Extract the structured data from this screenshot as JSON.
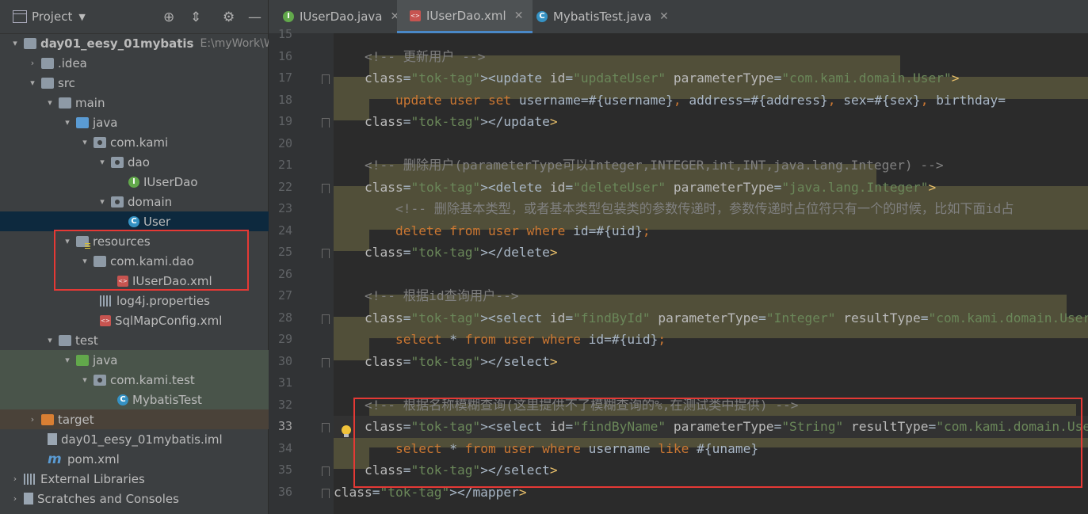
{
  "project_panel": {
    "title": "Project",
    "tree": [
      {
        "label": "day01_eesy_01mybatis",
        "path": "E:\\myWork\\W"
      },
      {
        "label": ".idea"
      },
      {
        "label": "src"
      },
      {
        "label": "main"
      },
      {
        "label": "java"
      },
      {
        "label": "com.kami"
      },
      {
        "label": "dao"
      },
      {
        "label": "IUserDao"
      },
      {
        "label": "domain"
      },
      {
        "label": "User"
      },
      {
        "label": "resources"
      },
      {
        "label": "com.kami.dao"
      },
      {
        "label": "IUserDao.xml"
      },
      {
        "label": "log4j.properties"
      },
      {
        "label": "SqlMapConfig.xml"
      },
      {
        "label": "test"
      },
      {
        "label": "java"
      },
      {
        "label": "com.kami.test"
      },
      {
        "label": "MybatisTest"
      },
      {
        "label": "target"
      },
      {
        "label": "day01_eesy_01mybatis.iml"
      },
      {
        "label": "pom.xml"
      },
      {
        "label": "External Libraries"
      },
      {
        "label": "Scratches and Consoles"
      }
    ]
  },
  "tabs": [
    {
      "label": "IUserDao.java",
      "active": false
    },
    {
      "label": "IUserDao.xml",
      "active": true
    },
    {
      "label": "MybatisTest.java",
      "active": false
    }
  ],
  "editor": {
    "current_line": 33,
    "lines": [
      {
        "n": "15",
        "text": ""
      },
      {
        "n": "16",
        "text": "    <!-- 更新用户 -->"
      },
      {
        "n": "17",
        "text": "    <update id=\"updateUser\" parameterType=\"com.kami.domain.User\">"
      },
      {
        "n": "18",
        "text": "        update user set username=#{username}, address=#{address}, sex=#{sex}, birthday="
      },
      {
        "n": "19",
        "text": "    </update>"
      },
      {
        "n": "20",
        "text": ""
      },
      {
        "n": "21",
        "text": "    <!-- 删除用户(parameterType可以Integer,INTEGER,int,INT,java.lang.Integer) -->"
      },
      {
        "n": "22",
        "text": "    <delete id=\"deleteUser\" parameterType=\"java.lang.Integer\">"
      },
      {
        "n": "23",
        "text": "        <!-- 删除基本类型，或者基本类型包装类的参数传递时，参数传递时占位符只有一个的时候，比如下面id占"
      },
      {
        "n": "24",
        "text": "        delete from user where id=#{uid};"
      },
      {
        "n": "25",
        "text": "    </delete>"
      },
      {
        "n": "26",
        "text": ""
      },
      {
        "n": "27",
        "text": "    <!-- 根据id查询用户-->"
      },
      {
        "n": "28",
        "text": "    <select id=\"findById\" parameterType=\"Integer\" resultType=\"com.kami.domain.User\">"
      },
      {
        "n": "29",
        "text": "        select * from user where id=#{uid};"
      },
      {
        "n": "30",
        "text": "    </select>"
      },
      {
        "n": "31",
        "text": ""
      },
      {
        "n": "32",
        "text": "    <!-- 根据名称模糊查询(这里提供不了模糊查询的%,在测试类中提供) -->"
      },
      {
        "n": "33",
        "text": "    <select id=\"findByName\" parameterType=\"String\" resultType=\"com.kami.domain.User\">"
      },
      {
        "n": "34",
        "text": "        select * from user where username like #{uname}"
      },
      {
        "n": "35",
        "text": "    </select>"
      },
      {
        "n": "36",
        "text": "</mapper>"
      }
    ]
  }
}
